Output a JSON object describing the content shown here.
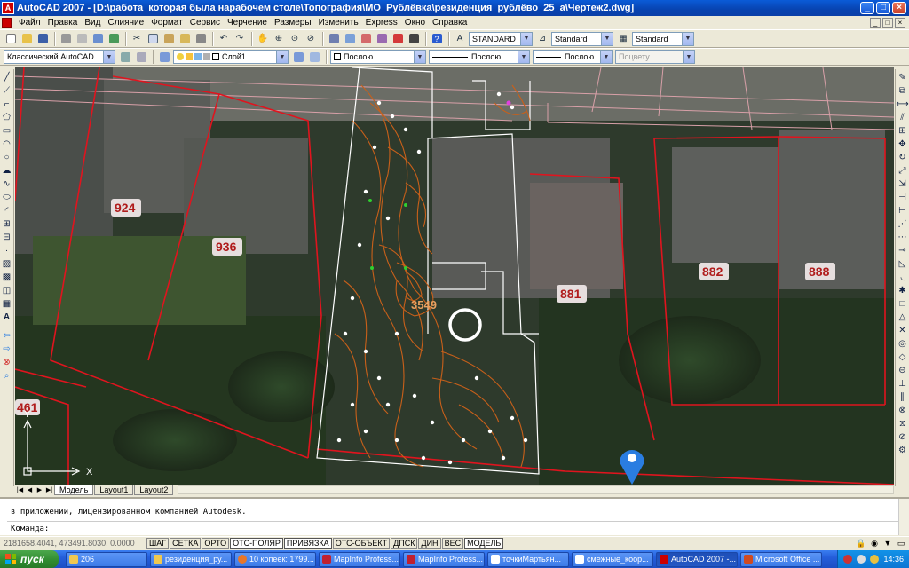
{
  "window": {
    "title": "AutoCAD 2007 - [D:\\работа_которая была нарабочем столе\\Топография\\МО_Рублёвка\\резиденция_рублёво_25_а\\Чертеж2.dwg]",
    "icon_text": "A",
    "controls": [
      "_",
      "□",
      "×"
    ]
  },
  "menu": [
    "Файл",
    "Правка",
    "Вид",
    "Слияние",
    "Формат",
    "Сервис",
    "Черчение",
    "Размеры",
    "Изменить",
    "Express",
    "Окно",
    "Справка"
  ],
  "menu_mdi": [
    "_",
    "□",
    "×"
  ],
  "toolbar1": {
    "text_style": "STANDARD",
    "dim_style": "Standard",
    "table_style": "Standard"
  },
  "toolbar2": {
    "workspace": "Классический AutoCAD",
    "layer": "Слой1",
    "color": "Послою",
    "linetype": "Послою",
    "lineweight": "Послою",
    "plotstyle": "Поцвету"
  },
  "drawing": {
    "parcel_labels": [
      "924",
      "936",
      "881",
      "882",
      "888",
      "461",
      "3549"
    ],
    "colors": {
      "boundary": "#e0141e",
      "contour": "#c8601a",
      "road": "#d8a0a8",
      "outline": "#ffffff",
      "tree_marker": "#ffffff",
      "point_green": "#2fd02f",
      "location_pin": "#2a7de1"
    },
    "axis": {
      "x": "X",
      "y": "Y"
    }
  },
  "tabs": [
    "Модель",
    "Layout1",
    "Layout2"
  ],
  "command": {
    "history": "в приложении, лицензированном компанией Autodesk.",
    "prompt": "Команда:"
  },
  "status": {
    "coords": "2181658.4041, 473491.8030, 0.0000",
    "buttons": [
      "ШАГ",
      "СЕТКА",
      "ОРТО",
      "ОТС-ПОЛЯР",
      "ПРИВЯЗКА",
      "ОТС-ОБЪЕКТ",
      "ДПСК",
      "ДИН",
      "ВЕС",
      "МОДЕЛЬ"
    ],
    "active": [
      "ОТС-ПОЛЯР",
      "ПРИВЯЗКА",
      "МОДЕЛЬ"
    ]
  },
  "taskbar": {
    "start": "пуск",
    "tasks": [
      "206",
      "резиденция_ру...",
      "10 копеек: 1799...",
      "MapInfo Profess...",
      "MapInfo Profess...",
      "точкиМартьян...",
      "смежные_коор...",
      "AutoCAD 2007 -...",
      "Microsoft Office ..."
    ],
    "active_task": "AutoCAD 2007 -...",
    "clock": "14:36"
  }
}
